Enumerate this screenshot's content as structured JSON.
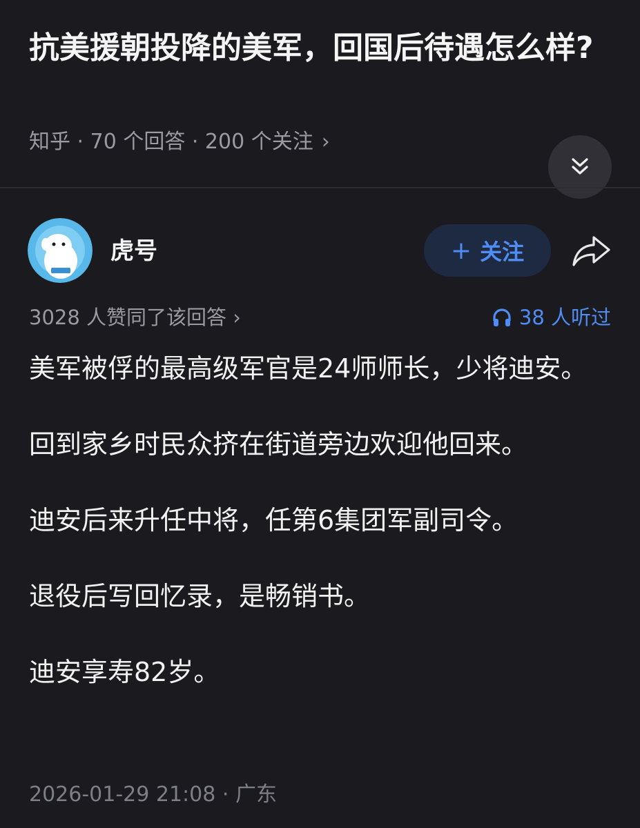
{
  "question": {
    "title": "抗美援朝投降的美军，回国后待遇怎么样?",
    "meta": "知乎 · 70 个回答 · 200 个关注",
    "meta_chevron": "›"
  },
  "answer": {
    "author": "虎号",
    "follow_label": "关注",
    "follow_plus": "+",
    "approve_text": "3028 人赞同了该回答",
    "approve_chevron": "›",
    "listen_text": "38 人听过",
    "paragraphs": [
      "美军被俘的最高级军官是24师师长，少将迪安。",
      "回到家乡时民众挤在街道旁边欢迎他回来。",
      "迪安后来升任中将，任第6集团军副司令。",
      "退役后写回忆录，是畅销书。",
      "迪安享寿82岁。"
    ],
    "footer": "2026-01-29 21:08 · 广东"
  },
  "colors": {
    "background": "#1a1a1f",
    "accent": "#4f8df5",
    "muted": "#9a9aa0"
  },
  "icons": {
    "collapse": "double-chevron-down-icon",
    "share": "share-arrow-icon",
    "listen": "headphones-icon"
  }
}
